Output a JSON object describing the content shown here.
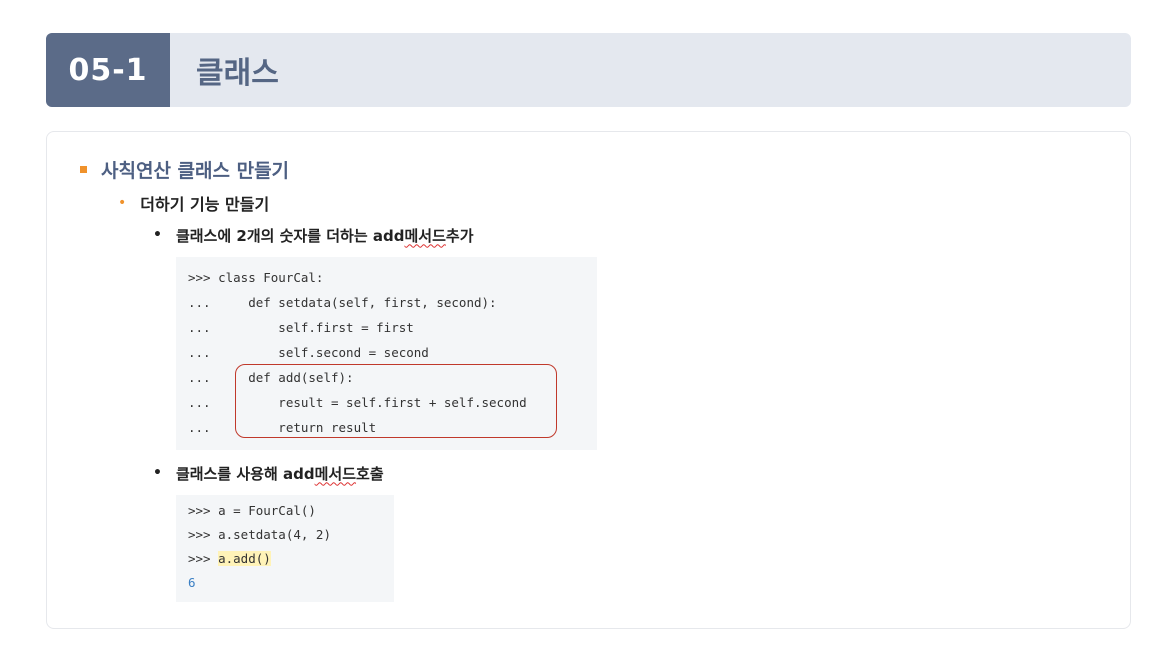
{
  "header": {
    "number": "05-1",
    "title": "클래스"
  },
  "outline": {
    "level1": "사칙연산 클래스 만들기",
    "level2": "더하기 기능 만들기",
    "bullet1": {
      "prefix": "클래스에 2개의 숫자를 더하는 add ",
      "squiggle": "메서드",
      "suffix": " 추가"
    },
    "bullet2": {
      "prefix": "클래스를 사용해 add ",
      "squiggle": "메서드",
      "suffix": " 호출"
    }
  },
  "code1": [
    ">>> class FourCal:",
    "...     def setdata(self, first, second):",
    "...         self.first = first",
    "...         self.second = second",
    "...     def add(self):",
    "...         result = self.first + self.second",
    "...         return result"
  ],
  "code2": {
    "line1": ">>> a = FourCal()",
    "line2": ">>> a.setdata(4, 2)",
    "prompt3": ">>> ",
    "call3": "a.add()",
    "result": "6"
  },
  "colors": {
    "accent": "#f0922b",
    "header_bg": "#e4e8ef",
    "number_bg": "#5b6b88",
    "highlight_box": "#c0392b"
  }
}
